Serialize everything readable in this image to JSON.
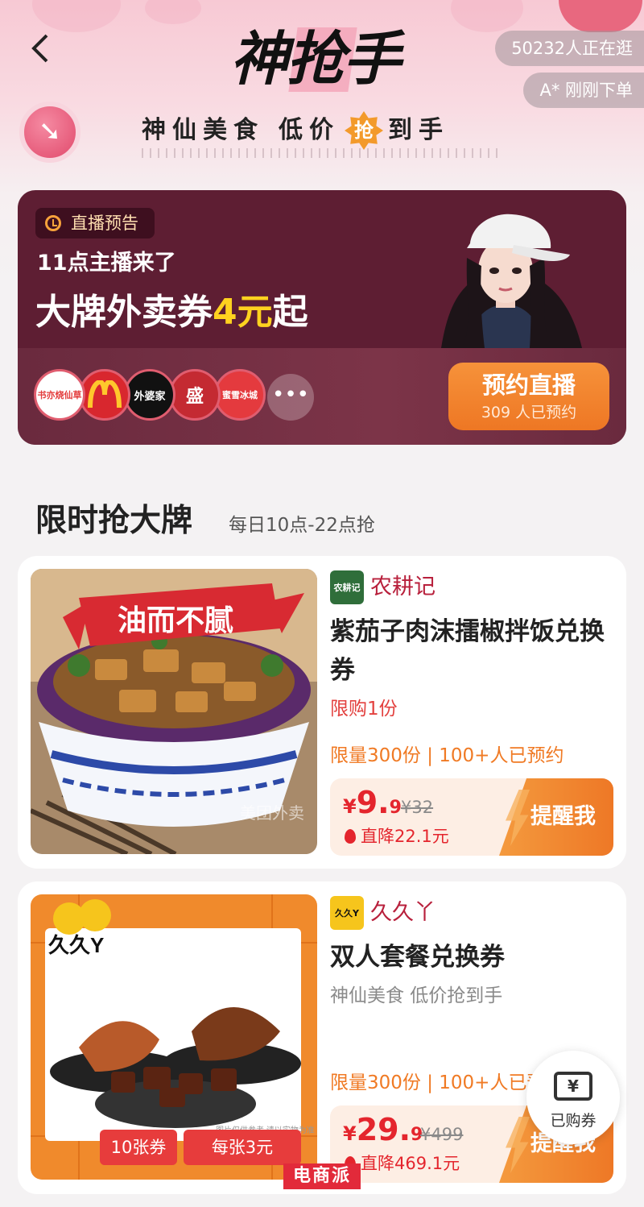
{
  "header": {
    "logo_text": "神抢手",
    "subtitle_left": "神仙美食",
    "subtitle_mid": "低价",
    "subtitle_badge": "抢",
    "subtitle_right": "到手",
    "browsing_count": "50232人正在逛",
    "recent_order": "A* 刚刚下单"
  },
  "live": {
    "tag": "直播预告",
    "line1": "11点主播来了",
    "line2_prefix": "大牌外卖券",
    "line2_highlight": "4元",
    "line2_suffix": "起",
    "brands": [
      "书亦烧仙草",
      "McDonald's",
      "外婆家",
      "盛",
      "蜜雪冰城"
    ],
    "more_label": "•••",
    "reserve_label": "预约直播",
    "reserve_count": "309 人已预约"
  },
  "section": {
    "title": "限时抢大牌",
    "subtitle": "每日10点-22点抢"
  },
  "products": [
    {
      "shop": "农耕记",
      "shop_logo_text": "农耕记",
      "title": "紫茄子肉沫擂椒拌饭兑换券",
      "limit": "限购1份",
      "stock": "限量300份 | 100+人已预约",
      "price_symbol": "¥",
      "price_int": "9.",
      "price_dec": "9",
      "price_old": "¥32",
      "drop": "直降22.1元",
      "remind_label": "提醒我",
      "image_banner": "油而不腻",
      "image_watermark": "美团外卖"
    },
    {
      "shop": "久久丫",
      "shop_logo_text": "久久Y",
      "title": "双人套餐兑换券",
      "desc": "神仙美食 低价抢到手",
      "stock": "限量300份 | 100+人已预约",
      "price_symbol": "¥",
      "price_int": "29.",
      "price_dec": "9",
      "price_old": "¥499",
      "drop": "直降469.1元",
      "remind_label": "提醒我",
      "image_brand": "久久Y",
      "image_note": "图片仅供参考 请以实物为准",
      "coupon_count": "10张券",
      "coupon_value": "每张3元"
    }
  ],
  "float": {
    "ticket_symbol": "¥",
    "bought_label": "已购券"
  },
  "watermark": "电商派",
  "colors": {
    "accent_red": "#e4252d",
    "accent_orange": "#ee7724",
    "live_bg": "#5e1e33",
    "shop_name": "#b8203c"
  }
}
